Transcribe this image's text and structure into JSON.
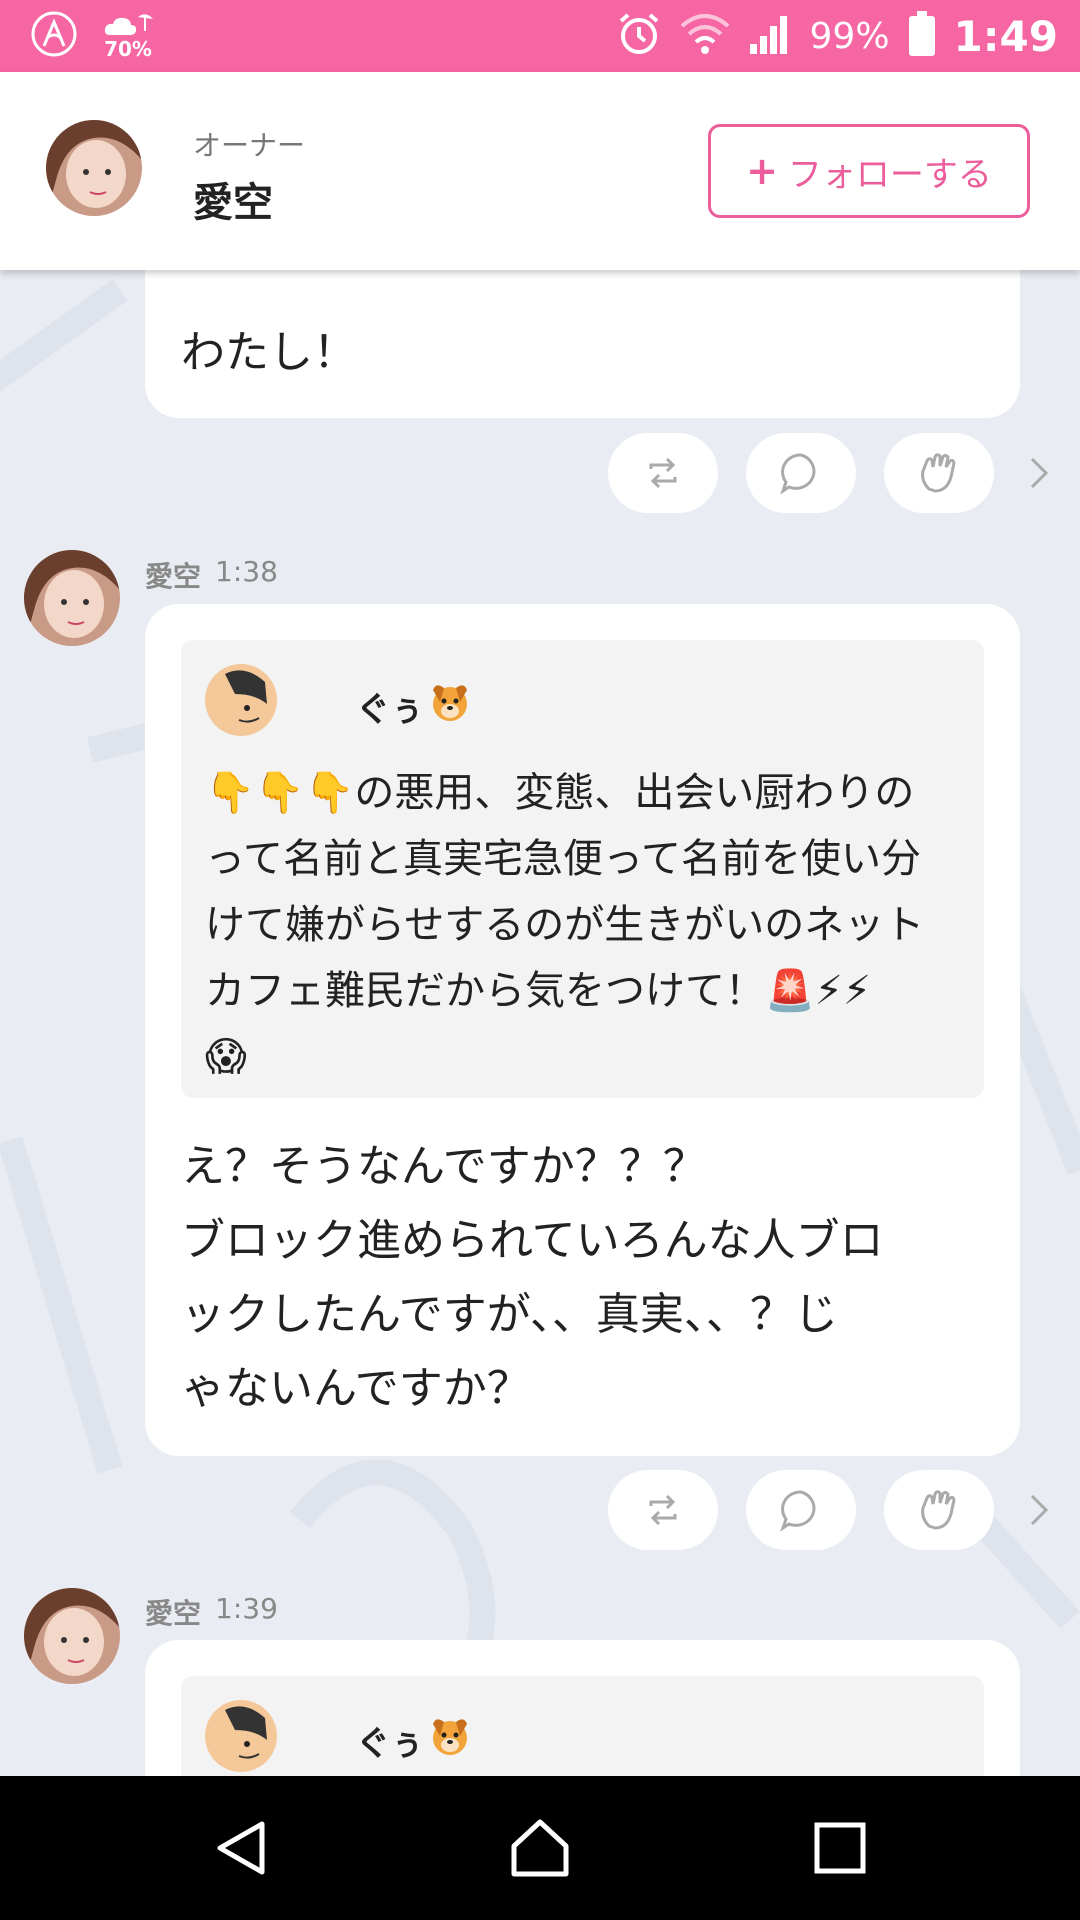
{
  "status_bar": {
    "weather_percent": "70%",
    "battery": "99%",
    "time": "1:49"
  },
  "header": {
    "role": "オーナー",
    "name": "愛空",
    "follow_label": "フォローする",
    "follow_plus": "+"
  },
  "messages": [
    {
      "text_lines": [
        "わたし！"
      ]
    },
    {
      "author": "愛空",
      "time": "1:38",
      "quote": {
        "name": "ぐぅ",
        "lines": [
          "👇👇👇の悪用、変態、出会い厨わりの",
          "って名前と真実宅急便って名前を使い分",
          "けて嫌がらせするのが生きがいのネット",
          "カフェ難民だから気をつけて！🚨⚡⚡",
          "😱"
        ]
      },
      "text_lines": [
        "え？そうなんですか？？？",
        "ブロック進められていろんな人ブロ",
        "ックしたんですが、、真実、、？じ",
        "ゃないんですか？"
      ]
    },
    {
      "author": "愛空",
      "time": "1:39",
      "quote": {
        "name": "ぐぅ"
      }
    }
  ],
  "colors": {
    "brand_pink": "#f566a3",
    "follow_pink": "#ec5d9c",
    "background": "#e9edf3"
  },
  "icons": {
    "repost": "repost-icon",
    "comment": "comment-icon",
    "clap": "clap-icon",
    "chevron": "chevron-right-icon"
  }
}
